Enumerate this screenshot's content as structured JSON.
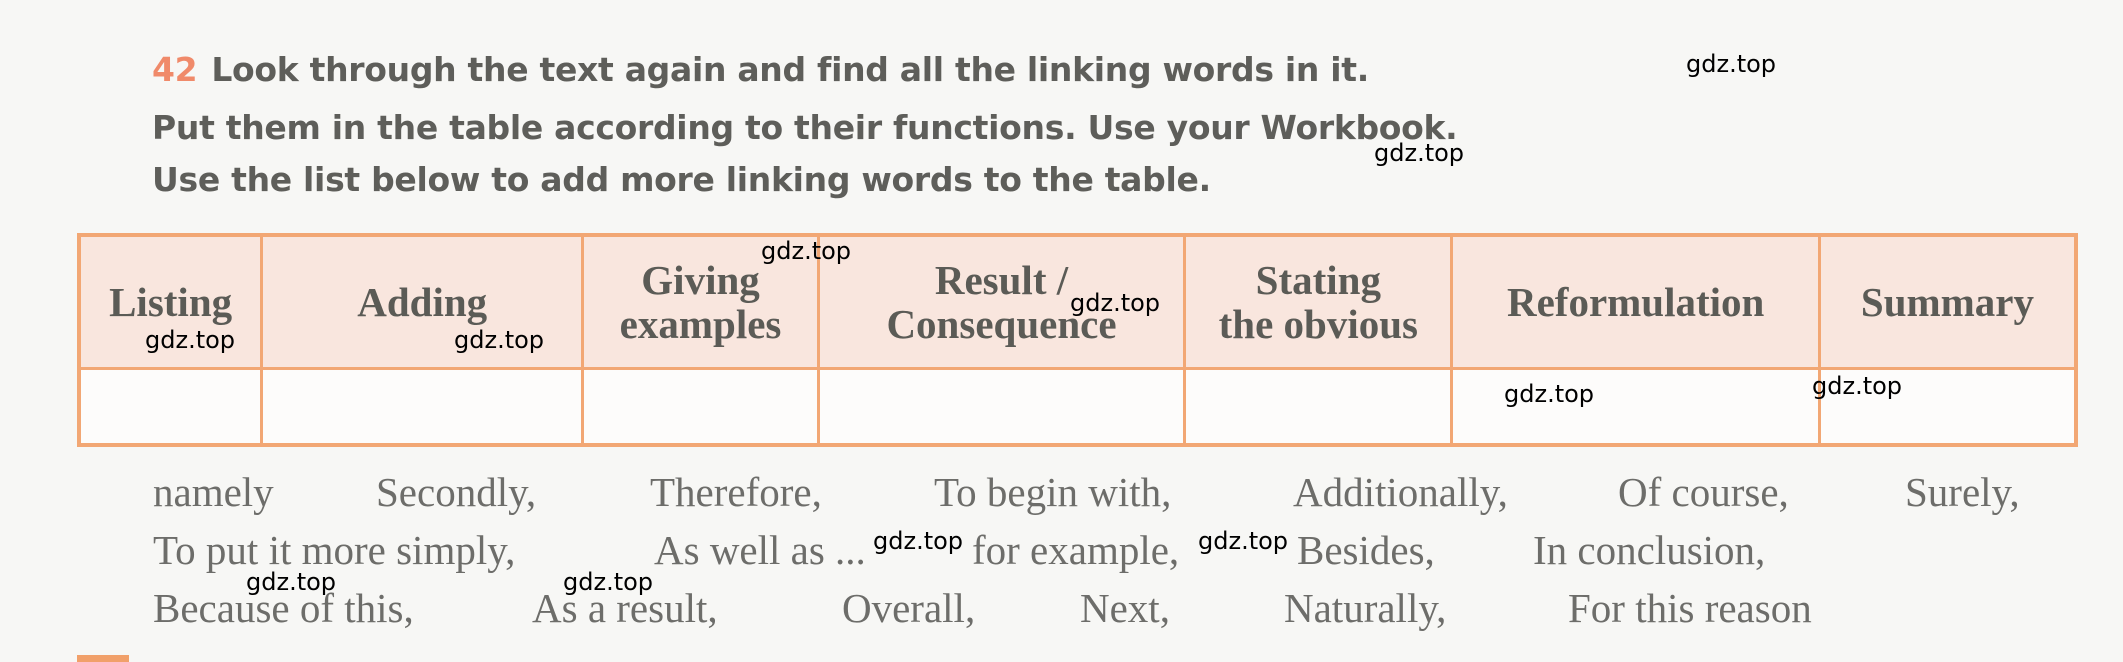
{
  "exercise": {
    "number": "42",
    "lines": [
      "Look through the text again and find all the linking words in it.",
      "Put them in the table according to their functions. Use your Workbook.",
      "Use the list below to add more linking words to the table."
    ]
  },
  "table": {
    "headers": [
      "Listing",
      "Adding",
      "Giving examples",
      "Result / Consequence",
      "Stating the obvious",
      "Reformulation",
      "Summary"
    ],
    "header_lines": [
      [
        "Listing"
      ],
      [
        "Adding"
      ],
      [
        "Giving",
        "examples"
      ],
      [
        "Result /",
        "Consequence"
      ],
      [
        "Stating",
        "the obvious"
      ],
      [
        "Reformulation"
      ],
      [
        "Summary"
      ]
    ]
  },
  "word_list": [
    [
      "namely",
      "Secondly,",
      "Therefore,",
      "To begin with,",
      "Additionally,",
      "Of course,",
      "Surely,"
    ],
    [
      "To put it more simply,",
      "As well as ...",
      "for example,",
      "Besides,",
      "In conclusion,"
    ],
    [
      "Because of this,",
      "As a result,",
      "Overall,",
      "Next,",
      "Naturally,",
      "For this reason"
    ]
  ],
  "watermark": "gdz.top",
  "colors": {
    "number": "#f08a6a",
    "table_border": "#f2a774",
    "header_bg": "#f9e6de"
  }
}
